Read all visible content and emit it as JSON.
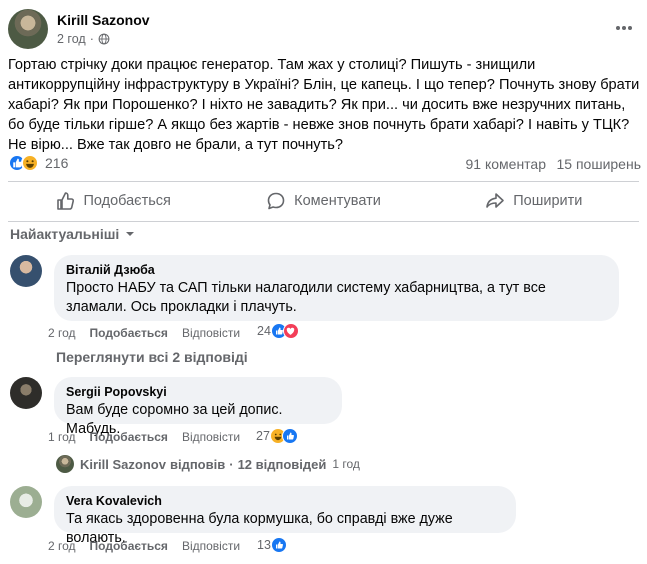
{
  "post": {
    "author": "Kirill Sazonov",
    "time": "2 год",
    "text": "Гортаю стрічку доки працює генератор. Там жах у столиці? Пишуть - знищили антикоррупційну інфраструктуру в Україні? Блін, це капець. І що тепер? Почнуть знову брати хабарі? Як при Порошенко? І ніхто не завадить? Як при... чи досить вже незручних питань, бо буде тільки гірше? А якщо без жартів - невже знов почнуть брати хабарі? І навіть у ТЦК? Не вірю...  Вже так довго не брали, а тут почнуть?",
    "reaction_count": "216",
    "comments_count": "91 коментар",
    "shares_count": "15 поширень"
  },
  "actions": {
    "like": "Подобається",
    "comment": "Коментувати",
    "share": "Поширити"
  },
  "sort_label": "Найактуальніші",
  "comments": [
    {
      "author": "Віталій Дзюба",
      "text": "Просто НАБУ та САП тільки налагодили систему хабарництва, а тут все зламали. Ось прокладки і плачуть.",
      "time": "2 год",
      "like": "Подобається",
      "reply": "Відповісти",
      "reactions": "24"
    },
    {
      "author": "Sergii Popovskyi",
      "text": "Вам буде соромно за цей допис. Мабудь.",
      "time": "1 год",
      "like": "Подобається",
      "reply": "Відповісти",
      "reactions": "27"
    },
    {
      "author": "Vera Kovalevich",
      "text": "Та якась здоровенна була кормушка, бо справді вже дуже волають.",
      "time": "2 год",
      "like": "Подобається",
      "reply": "Відповісти",
      "reactions": "13"
    }
  ],
  "view_replies": "Переглянути всі 2 відповіді",
  "reply_summary": {
    "author": "Kirill Sazonov",
    "verb": "відповів",
    "sep": "·",
    "count": "12 відповідей",
    "time": "1 год"
  },
  "colors": {
    "like_blue": "#1877f2",
    "love_red": "#f33e58",
    "haha_yellow": "#f7b125",
    "muted": "#65676b",
    "bubble": "#f0f2f5"
  }
}
